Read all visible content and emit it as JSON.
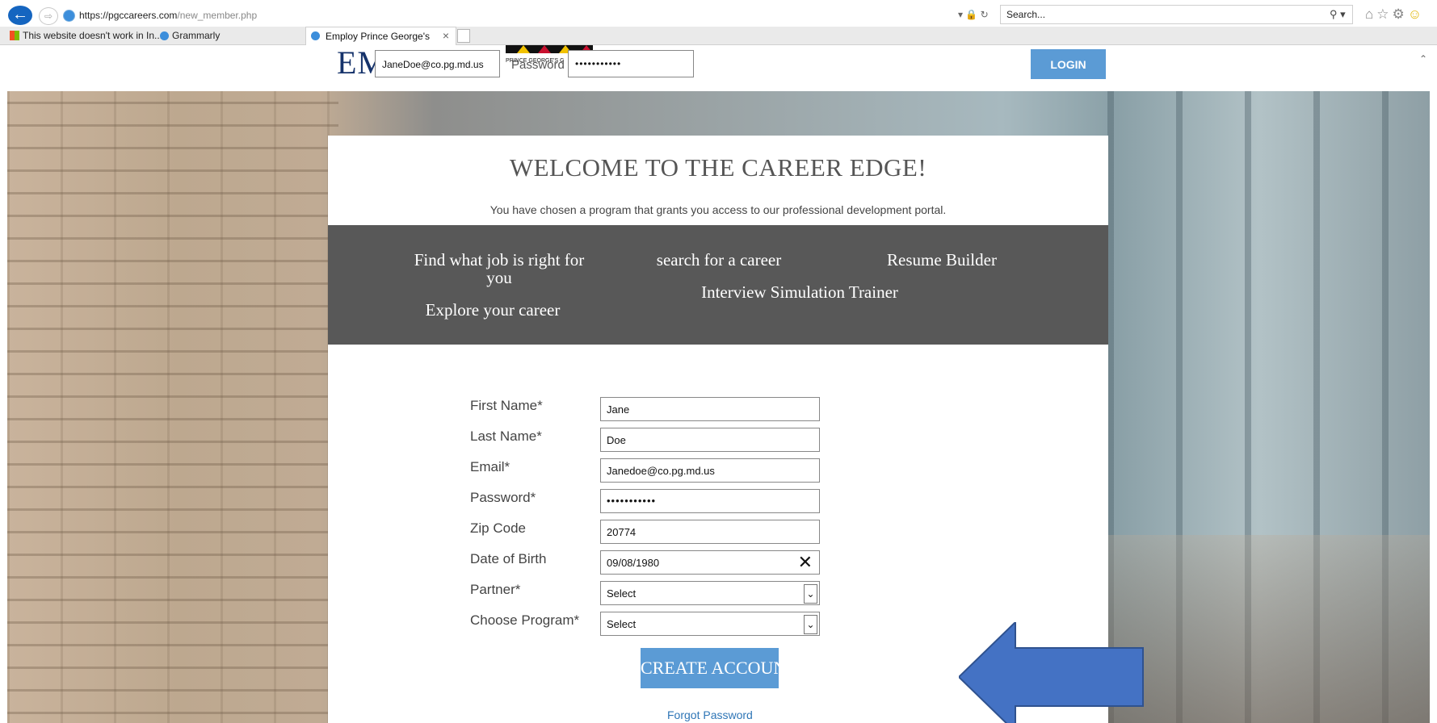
{
  "browser": {
    "url_host": "https://pgccareers.com",
    "url_path": "/new_member.php",
    "search_placeholder": "Search...",
    "favorites": [
      "This website doesn't work in In...",
      "Grammarly"
    ],
    "tab_title": "Employ Prince George's"
  },
  "header": {
    "logo_text": "EMPLOY",
    "login_email_value": "JaneDoe@co.pg.md.us",
    "password_label": "Password",
    "login_password_value": "•••••••••••",
    "seal_text": "PRINCE GEORGE'S C",
    "login_button": "LOGIN"
  },
  "card": {
    "title": "WELCOME TO THE CAREER EDGE!",
    "intro": "You have chosen a program that grants you access to our professional development portal.",
    "features": [
      "Find what job is right for you",
      "search for a career",
      "Resume Builder",
      "Interview Simulation Trainer",
      "Explore your career"
    ]
  },
  "form": {
    "first_name": {
      "label": "First Name*",
      "value": "Jane"
    },
    "last_name": {
      "label": "Last Name*",
      "value": "Doe"
    },
    "email": {
      "label": "Email*",
      "value": "Janedoe@co.pg.md.us"
    },
    "password": {
      "label": "Password*",
      "value": "•••••••••••"
    },
    "zip": {
      "label": "Zip Code",
      "value": "20774"
    },
    "dob": {
      "label": "Date of Birth",
      "value": "09/08/1980"
    },
    "partner": {
      "label": "Partner*",
      "value": "Select"
    },
    "program": {
      "label": "Choose Program*",
      "value": "Select"
    },
    "create_button": "CREATE ACCOUNT",
    "forgot_link": "Forgot Password"
  },
  "colors": {
    "accent": "#5b9bd5",
    "features_bg": "#585858",
    "arrow": "#4472c4"
  }
}
